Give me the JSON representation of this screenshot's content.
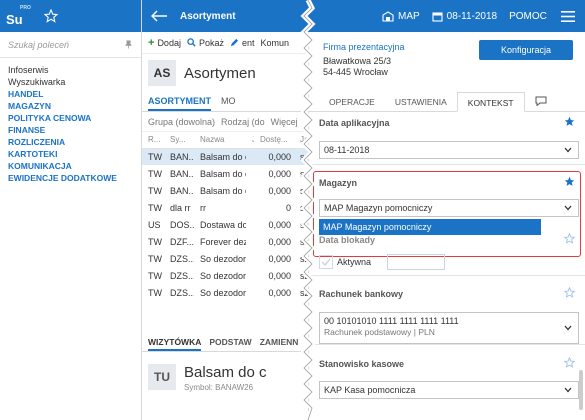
{
  "app": {
    "logo_text": "Su",
    "logo_badge": "PRO"
  },
  "sidebar": {
    "search_placeholder": "Szukaj poleceń",
    "items": [
      {
        "label": "Infoserwis",
        "cat": false
      },
      {
        "label": "Wyszukiwarka",
        "cat": false
      },
      {
        "label": "HANDEL",
        "cat": true
      },
      {
        "label": "MAGAZYN",
        "cat": true
      },
      {
        "label": "POLITYKA CENOWA",
        "cat": true
      },
      {
        "label": "FINANSE",
        "cat": true
      },
      {
        "label": "ROZLICZENIA",
        "cat": true
      },
      {
        "label": "KARTOTEKI",
        "cat": true
      },
      {
        "label": "KOMUNIKACJA",
        "cat": true
      },
      {
        "label": "EWIDENCJE DODATKOWE",
        "cat": true
      }
    ]
  },
  "middle": {
    "title": "Asortyment",
    "toolbar": {
      "add": "Dodaj",
      "show": "Pokaż",
      "edit": "ent",
      "comm": "Komun"
    },
    "badge": "AS",
    "header_title": "Asortymen",
    "tabs": [
      "ASORTYMENT",
      "MO"
    ],
    "filters": [
      "Grupa (dowolna)",
      "Rodzaj (do",
      "Więcej"
    ],
    "columns": [
      "R...",
      "Sy...",
      "Nazwa",
      "Ja",
      "Dostę...",
      "Ja"
    ],
    "rows": [
      {
        "r": "TW",
        "sym": "BAN...",
        "name": "Balsam do ciał",
        "qty": "0,000",
        "u": "sz"
      },
      {
        "r": "TW",
        "sym": "BAN...",
        "name": "Balsam do ciał",
        "qty": "0,000",
        "u": "sz"
      },
      {
        "r": "TW",
        "sym": "BAN...",
        "name": "Balsam do ciał",
        "qty": "0,000",
        "u": "sz"
      },
      {
        "r": "TW",
        "sym": "dla rr",
        "name": "rr",
        "qty": "0",
        "u": "sz"
      },
      {
        "r": "US",
        "sym": "DOS...",
        "name": "Dostawa do kl",
        "qty": "0,000",
        "u": "sz"
      },
      {
        "r": "TW",
        "sym": "DZF...",
        "name": "Forever dezod",
        "qty": "0,000",
        "u": "sz"
      },
      {
        "r": "TW",
        "sym": "DZS...",
        "name": "So dezodoran",
        "qty": "0,000",
        "u": "sz"
      },
      {
        "r": "TW",
        "sym": "DZS...",
        "name": "So dezodoran",
        "qty": "0,000",
        "u": "sz"
      },
      {
        "r": "TW",
        "sym": "DZS...",
        "name": "So dezodoran",
        "qty": "0,000",
        "u": "sz"
      }
    ],
    "bottom_tabs": [
      "WIZYTÓWKA",
      "PODSTAW",
      "ZAMIENN"
    ],
    "detail_badge": "TU",
    "detail_name": "Balsam do c",
    "detail_symbol": "Symbol: BANAW26"
  },
  "topbar": {
    "warehouse": "MAP",
    "date": "08-11-2018",
    "help": "POMOC"
  },
  "panel": {
    "company": "Firma prezentacyjna",
    "address1": "Bławatkowa 25/3",
    "address2": "54-445 Wrocław",
    "config_button": "Konfiguracja",
    "tabs": [
      "OPERACJE",
      "USTAWIENIA",
      "KONTEKST"
    ],
    "sections": {
      "app_date": {
        "title": "Data aplikacyjna",
        "value": "08-11-2018"
      },
      "warehouse": {
        "title": "Magazyn",
        "value": "MAP Magazyn pomocniczy",
        "dropdown_option": "MAP Magazyn pomocniczy"
      },
      "lock_date": {
        "title": "Data blokady",
        "active_label": "Aktywna"
      },
      "bank": {
        "title": "Rachunek bankowy",
        "number": "00 10101010 1111 1111 1111 1111",
        "desc": "Rachunek podstawowy | PLN"
      },
      "cash": {
        "title": "Stanowisko kasowe",
        "value": "KAP Kasa pomocnicza"
      }
    }
  },
  "colors": {
    "brand": "#1a73c4",
    "selection": "#dbe9f7",
    "highlight": "#e33b3b"
  }
}
